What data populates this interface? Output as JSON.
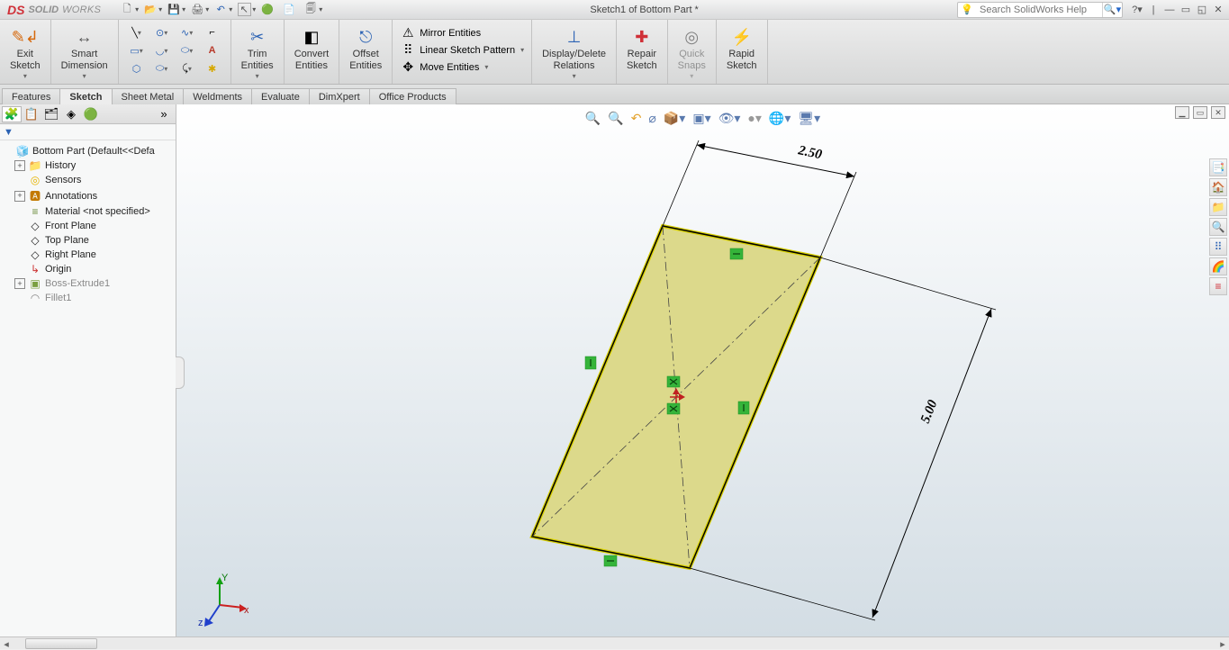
{
  "title": "Sketch1 of Bottom Part *",
  "search_placeholder": "Search SolidWorks Help",
  "logo": {
    "ds": "DS",
    "solid": "SOLID",
    "works": "WORKS"
  },
  "ribbon": {
    "exit_sketch": "Exit\nSketch",
    "smart_dim": "Smart\nDimension",
    "trim": "Trim\nEntities",
    "convert": "Convert\nEntities",
    "offset": "Offset\nEntities",
    "mirror": "Mirror Entities",
    "lin_pat": "Linear Sketch Pattern",
    "move": "Move Entities",
    "disp_del": "Display/Delete\nRelations",
    "repair": "Repair\nSketch",
    "quick": "Quick\nSnaps",
    "rapid": "Rapid\nSketch"
  },
  "tabs": [
    "Features",
    "Sketch",
    "Sheet Metal",
    "Weldments",
    "Evaluate",
    "DimXpert",
    "Office Products"
  ],
  "tree": {
    "root": "Bottom Part  (Default<<Defa",
    "items": [
      {
        "exp": "+",
        "ico": "📁",
        "txt": "History"
      },
      {
        "exp": "",
        "ico": "🟡",
        "txt": "Sensors"
      },
      {
        "exp": "+",
        "ico": "🅰",
        "txt": "Annotations"
      },
      {
        "exp": "",
        "ico": "≡",
        "txt": "Material <not specified>"
      },
      {
        "exp": "",
        "ico": "◇",
        "txt": "Front Plane"
      },
      {
        "exp": "",
        "ico": "◇",
        "txt": "Top Plane"
      },
      {
        "exp": "",
        "ico": "◇",
        "txt": "Right Plane"
      },
      {
        "exp": "",
        "ico": "↳",
        "txt": "Origin"
      },
      {
        "exp": "+",
        "ico": "▣",
        "txt": "Boss-Extrude1"
      },
      {
        "exp": "",
        "ico": "◠",
        "txt": "Fillet1"
      }
    ]
  },
  "dims": {
    "w": "2.50",
    "h": "5.00"
  },
  "triad": {
    "x": "x",
    "y": "Y",
    "z": "z"
  }
}
